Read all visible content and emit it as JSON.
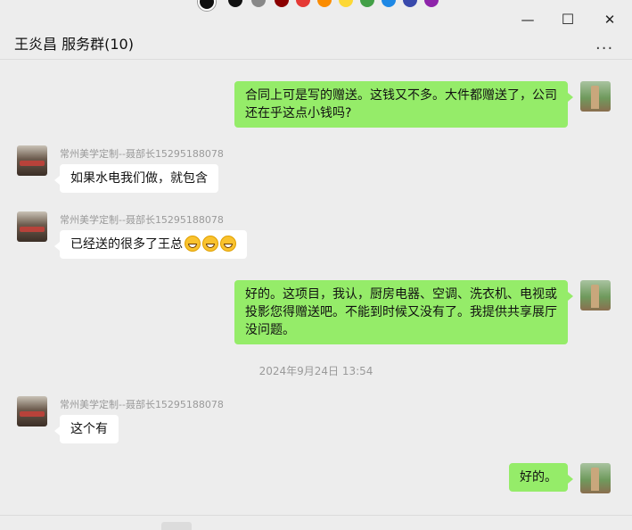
{
  "window": {
    "title": "王炎昌 服务群(10)",
    "minimize_glyph": "—",
    "maximize_glyph": "☐",
    "close_glyph": "✕",
    "more_glyph": "···"
  },
  "colors": {
    "my_bubble": "#95ec69",
    "other_bubble": "#ffffff",
    "background": "#ededed",
    "muted_text": "#9a9a9a"
  },
  "messages": [
    {
      "side": "me",
      "text": "合同上可是写的赠送。这钱又不多。大件都赠送了，公司还在乎这点小钱吗?"
    },
    {
      "side": "other",
      "sender": "常州美学定制--聂部长15295188078",
      "text": "如果水电我们做，就包含"
    },
    {
      "side": "other",
      "sender": "常州美学定制--聂部长15295188078",
      "text": "已经送的很多了王总",
      "emoji_count": 3
    },
    {
      "side": "me",
      "text": "好的。这项目，我认，厨房电器、空调、洗衣机、电视或投影您得赠送吧。不能到时候又没有了。我提供共享展厅没问题。"
    },
    {
      "side": "other",
      "sender": "常州美学定制--聂部长15295188078",
      "text": "这个有"
    },
    {
      "side": "me",
      "text": "好的。"
    }
  ],
  "timestamp": "2024年9月24日 13:54"
}
